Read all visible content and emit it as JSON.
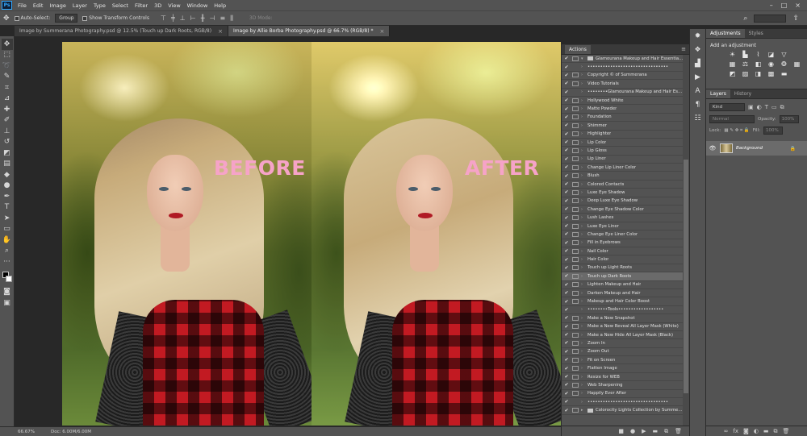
{
  "menubar": {
    "logo": "Ps",
    "items": [
      "File",
      "Edit",
      "Image",
      "Layer",
      "Type",
      "Select",
      "Filter",
      "3D",
      "View",
      "Window",
      "Help"
    ],
    "window_controls": [
      "–",
      "□",
      "×"
    ]
  },
  "options": {
    "auto_select_label": "Auto-Select:",
    "auto_select_value": "Group",
    "transform_label": "Show Transform Controls",
    "mode_3d_label": "3D Mode:"
  },
  "tabs": [
    {
      "label": "Image by Summerana Photography.psd @ 12.5% (Touch up Dark Roots, RGB/8)",
      "active": false
    },
    {
      "label": "Image by Allie Borba Photography.psd @ 66.7% (RGB/8) *",
      "active": true
    }
  ],
  "canvas": {
    "before_label": "BEFORE",
    "after_label": "AFTER"
  },
  "status": {
    "zoom": "66.67%",
    "doc": "Doc: 6.00M/6.00M"
  },
  "actions_panel": {
    "tab": "Actions",
    "rows": [
      {
        "label": "Glamourana Makeup and Hair Essentials ...",
        "type": "set",
        "checked": true,
        "dialog": true,
        "sel": false
      },
      {
        "label": "••••••••••••••••••••••••••••••••",
        "type": "action",
        "checked": true,
        "dialog": false,
        "sel": false
      },
      {
        "label": "Copyright © of Summerana",
        "type": "action",
        "checked": true,
        "dialog": true,
        "sel": false
      },
      {
        "label": "Video Tutorials",
        "type": "action",
        "checked": true,
        "dialog": true,
        "sel": false
      },
      {
        "label": "••••••••Glamourana Makeup and Hair Ess...",
        "type": "action",
        "checked": true,
        "dialog": false,
        "sel": false
      },
      {
        "label": "Hollywood White",
        "type": "action",
        "checked": true,
        "dialog": true,
        "sel": false
      },
      {
        "label": "Matte Powder",
        "type": "action",
        "checked": true,
        "dialog": true,
        "sel": false
      },
      {
        "label": "Foundation",
        "type": "action",
        "checked": true,
        "dialog": true,
        "sel": false
      },
      {
        "label": "Shimmer",
        "type": "action",
        "checked": true,
        "dialog": true,
        "sel": false
      },
      {
        "label": "Highlighter",
        "type": "action",
        "checked": true,
        "dialog": true,
        "sel": false
      },
      {
        "label": "Lip Color",
        "type": "action",
        "checked": true,
        "dialog": true,
        "sel": false
      },
      {
        "label": "Lip Gloss",
        "type": "action",
        "checked": true,
        "dialog": true,
        "sel": false
      },
      {
        "label": "Lip Liner",
        "type": "action",
        "checked": true,
        "dialog": true,
        "sel": false
      },
      {
        "label": "Change Lip Liner Color",
        "type": "action",
        "checked": true,
        "dialog": true,
        "sel": false
      },
      {
        "label": "Blush",
        "type": "action",
        "checked": true,
        "dialog": true,
        "sel": false
      },
      {
        "label": "Colored Contacts",
        "type": "action",
        "checked": true,
        "dialog": true,
        "sel": false
      },
      {
        "label": "Luxe Eye Shadow",
        "type": "action",
        "checked": true,
        "dialog": true,
        "sel": false
      },
      {
        "label": "Deep Luxe Eye Shadow",
        "type": "action",
        "checked": true,
        "dialog": true,
        "sel": false
      },
      {
        "label": "Change Eye Shadow Color",
        "type": "action",
        "checked": true,
        "dialog": true,
        "sel": false
      },
      {
        "label": "Lush Lashes",
        "type": "action",
        "checked": true,
        "dialog": true,
        "sel": false
      },
      {
        "label": "Luxe Eye Liner",
        "type": "action",
        "checked": true,
        "dialog": true,
        "sel": false
      },
      {
        "label": "Change Eye Liner Color",
        "type": "action",
        "checked": true,
        "dialog": true,
        "sel": false
      },
      {
        "label": "Fill in Eyebrows",
        "type": "action",
        "checked": true,
        "dialog": true,
        "sel": false
      },
      {
        "label": "Nail Color",
        "type": "action",
        "checked": true,
        "dialog": true,
        "sel": false
      },
      {
        "label": "Hair Color",
        "type": "action",
        "checked": true,
        "dialog": true,
        "sel": false
      },
      {
        "label": "Touch up Light Roots",
        "type": "action",
        "checked": true,
        "dialog": true,
        "sel": false
      },
      {
        "label": "Touch up Dark Roots",
        "type": "action",
        "checked": true,
        "dialog": true,
        "sel": true
      },
      {
        "label": "Lighten Makeup and Hair",
        "type": "action",
        "checked": true,
        "dialog": true,
        "sel": false
      },
      {
        "label": "Darken Makeup and Hair",
        "type": "action",
        "checked": true,
        "dialog": true,
        "sel": false
      },
      {
        "label": "Makeup and Hair Color Boost",
        "type": "action",
        "checked": true,
        "dialog": true,
        "sel": false
      },
      {
        "label": "••••••••Tools••••••••••••••••••",
        "type": "action",
        "checked": true,
        "dialog": false,
        "sel": false
      },
      {
        "label": "Make a New Snapshot",
        "type": "action",
        "checked": true,
        "dialog": true,
        "sel": false
      },
      {
        "label": "Make a New Reveal All Layer Mask (White)",
        "type": "action",
        "checked": true,
        "dialog": true,
        "sel": false
      },
      {
        "label": "Make a New Hide All Layer Mask (Black)",
        "type": "action",
        "checked": true,
        "dialog": true,
        "sel": false
      },
      {
        "label": "Zoom In",
        "type": "action",
        "checked": true,
        "dialog": true,
        "sel": false
      },
      {
        "label": "Zoom Out",
        "type": "action",
        "checked": true,
        "dialog": true,
        "sel": false
      },
      {
        "label": "Fit on Screen",
        "type": "action",
        "checked": true,
        "dialog": true,
        "sel": false
      },
      {
        "label": "Flatten Image",
        "type": "action",
        "checked": true,
        "dialog": true,
        "sel": false
      },
      {
        "label": "Resize for WEB",
        "type": "action",
        "checked": true,
        "dialog": true,
        "sel": false
      },
      {
        "label": "Web Sharpening",
        "type": "action",
        "checked": true,
        "dialog": true,
        "sel": false
      },
      {
        "label": "Happily Ever After",
        "type": "action",
        "checked": true,
        "dialog": true,
        "sel": false
      },
      {
        "label": "••••••••••••••••••••••••••••••••",
        "type": "action",
        "checked": true,
        "dialog": false,
        "sel": false
      },
      {
        "label": "Colorocity Lights Collection by Summerana",
        "type": "set",
        "checked": true,
        "dialog": true,
        "sel": false
      }
    ]
  },
  "right": {
    "top_tabs": [
      "Adjustments",
      "Styles"
    ],
    "adjust_title": "Add an adjustment",
    "layers_tabs": [
      "Layers",
      "History"
    ],
    "kind_placeholder": "Kind",
    "blend_mode": "Normal",
    "opacity_label": "Opacity:",
    "opacity_value": "100%",
    "lock_label": "Lock:",
    "fill_label": "Fill:",
    "fill_value": "100%",
    "layer_name": "Background"
  }
}
